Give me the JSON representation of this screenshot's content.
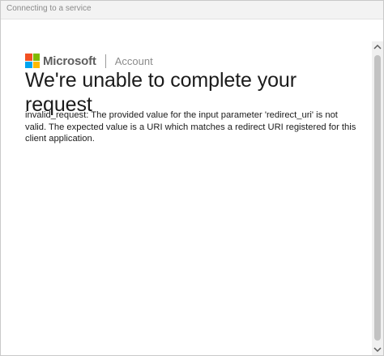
{
  "window": {
    "title": "Connecting to a service"
  },
  "brand": {
    "name": "Microsoft",
    "section": "Account",
    "logo_colors": [
      "#f25022",
      "#7fba00",
      "#00a4ef",
      "#ffb900"
    ]
  },
  "error": {
    "heading": "We're unable to complete your request",
    "message": "invalid_request: The provided value for the input parameter 'redirect_uri' is not valid. The expected value is a URI which matches a redirect URI registered for this client application."
  },
  "scrollbar": {
    "up_icon": "chevron-up-icon",
    "down_icon": "chevron-down-icon"
  }
}
